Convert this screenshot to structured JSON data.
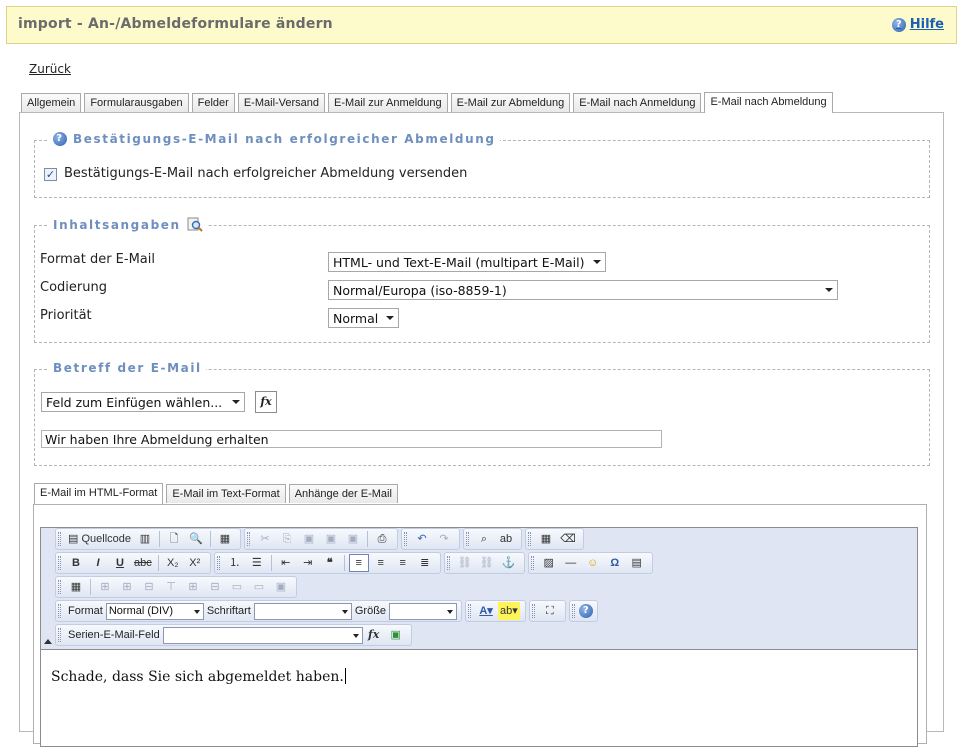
{
  "header": {
    "title": "import - An-/Abmeldeformulare ändern",
    "help_label": "Hilfe"
  },
  "back_link": "Zurück",
  "tabs": [
    {
      "label": "Allgemein"
    },
    {
      "label": "Formularausgaben"
    },
    {
      "label": "Felder"
    },
    {
      "label": "E-Mail-Versand"
    },
    {
      "label": "E-Mail zur Anmeldung"
    },
    {
      "label": "E-Mail zur Abmeldung"
    },
    {
      "label": "E-Mail nach Anmeldung"
    },
    {
      "label": "E-Mail nach Abmeldung"
    }
  ],
  "confirmation": {
    "legend": "Bestätigungs-E-Mail nach erfolgreicher Abmeldung",
    "checkbox_label": "Bestätigungs-E-Mail nach erfolgreicher Abmeldung versenden",
    "checked": true
  },
  "content_info": {
    "legend": "Inhaltsangaben",
    "format_label": "Format der E-Mail",
    "format_value": "HTML- und Text-E-Mail (multipart E-Mail)",
    "encoding_label": "Codierung",
    "encoding_value": "Normal/Europa (iso-8859-1)",
    "priority_label": "Priorität",
    "priority_value": "Normal"
  },
  "subject": {
    "legend": "Betreff der E-Mail",
    "field_select": "Feld zum Einfügen wählen...",
    "fx_label": "fx",
    "value": "Wir haben Ihre Abmeldung erhalten"
  },
  "subtabs": [
    {
      "label": "E-Mail im HTML-Format"
    },
    {
      "label": "E-Mail im Text-Format"
    },
    {
      "label": "Anhänge der E-Mail"
    }
  ],
  "editor": {
    "source_label": "Quellcode",
    "format_label": "Format",
    "format_value": "Normal (DIV)",
    "font_label": "Schriftart",
    "font_value": "",
    "size_label": "Größe",
    "size_value": "",
    "merge_label": "Serien-E-Mail-Feld",
    "merge_value": "",
    "merge_fx": "fx",
    "content": "Schade, dass Sie sich abgemeldet haben."
  }
}
